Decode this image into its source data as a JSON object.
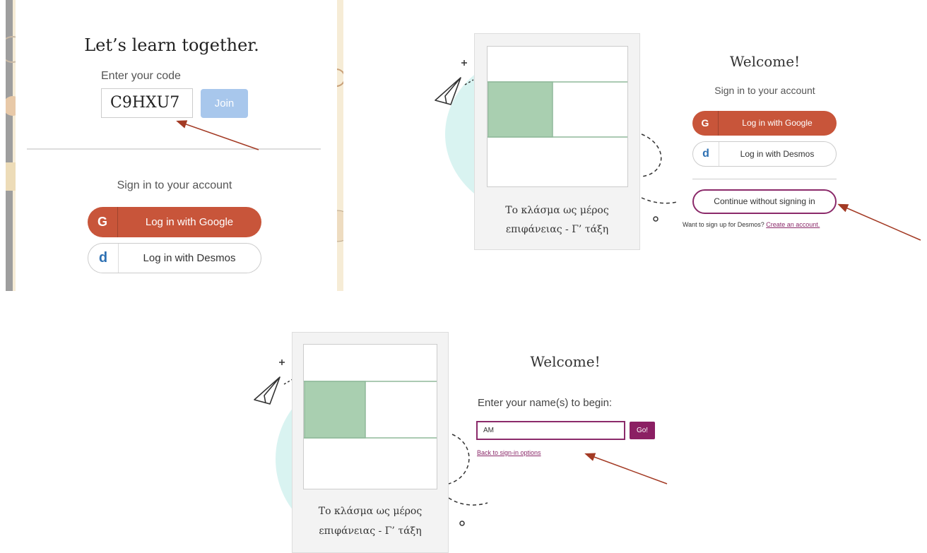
{
  "panel1": {
    "title": "Let’s learn together.",
    "code_label": "Enter your code",
    "code_value": "C9HXU7",
    "join_label": "Join",
    "signin_text": "Sign in to your account",
    "google_icon": "G",
    "google_label": "Log in with Google",
    "desmos_icon": "d",
    "desmos_label": "Log in with Desmos"
  },
  "panel2": {
    "activity_title_line1": "Το κλάσμα ως μέρος",
    "activity_title_line2": "επιφάνειας - Γ’ τάξη",
    "welcome": "Welcome!",
    "signin_text": "Sign in to your account",
    "google_icon": "G",
    "google_label": "Log in with Google",
    "desmos_icon": "d",
    "desmos_label": "Log in with Desmos",
    "continue_label": "Continue without signing in",
    "signup_text": "Want to sign up for Desmos?",
    "signup_link": "Create an account."
  },
  "panel3": {
    "activity_title_line1": "Το κλάσμα ως μέρος",
    "activity_title_line2": "επιφάνειας - Γ’ τάξη",
    "welcome": "Welcome!",
    "name_label": "Enter your name(s) to begin:",
    "name_value": "AM",
    "go_label": "Go!",
    "back_link": "Back to sign-in options"
  },
  "colors": {
    "google_orange": "#c8553a",
    "desmos_blue": "#2d70b3",
    "accent_purple": "#8b2a6a",
    "join_disabled": "#a8c7ec",
    "shape_green": "#a9cfb0",
    "teal_blob": "#d9f3f1",
    "arrow": "#a33a24"
  },
  "icons": [
    "google-icon",
    "desmos-icon",
    "paper-plane-icon",
    "plus-icon",
    "circle-icon"
  ]
}
